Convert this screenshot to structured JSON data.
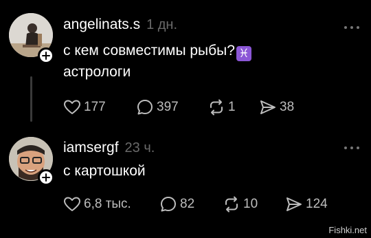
{
  "posts": [
    {
      "username": "angelinats.s",
      "time": "1 дн.",
      "text_line1": "с кем совместимы рыбы?",
      "emoji": "♓",
      "text_line2": "астрологи",
      "likes": "177",
      "comments": "397",
      "reposts": "1",
      "shares": "38"
    },
    {
      "username": "iamsergf",
      "time": "23 ч.",
      "text_line1": "с картошкой",
      "likes": "6,8 тыс.",
      "comments": "82",
      "reposts": "10",
      "shares": "124"
    }
  ],
  "watermark": "Fishki.net"
}
